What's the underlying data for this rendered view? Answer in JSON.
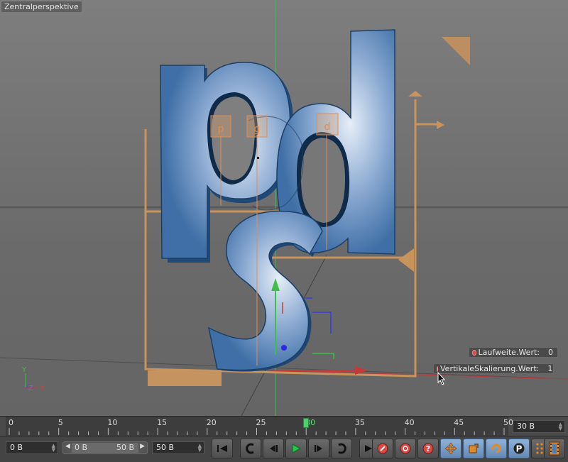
{
  "viewport": {
    "label": "Zentralperspektive",
    "axis_labels": {
      "y": "Y",
      "z": "Z",
      "x": "X"
    },
    "letters": [
      "p",
      "g",
      "d",
      "s"
    ],
    "hud": [
      {
        "label": "Laufweite.Wert:",
        "value": "0"
      },
      {
        "label": "VertikaleSkalierung.Wert:",
        "value": "1"
      }
    ]
  },
  "timeline": {
    "ticks": [
      "0",
      "5",
      "10",
      "15",
      "20",
      "25",
      "30",
      "35",
      "40",
      "45",
      "50"
    ],
    "current_frame": "30",
    "end_field": "30 B"
  },
  "controls": {
    "start_field": "0 B",
    "range_min": "0 B",
    "range_max": "50 B",
    "end_field": "50 B",
    "playback_buttons": [
      "go-to-start",
      "previous-key",
      "previous-frame",
      "play",
      "next-frame",
      "next-key",
      "go-to-end"
    ],
    "record_buttons": [
      "record-keys",
      "autokey",
      "help"
    ],
    "key_buttons": [
      "move",
      "scale",
      "rotate",
      "parameter",
      "point-level"
    ],
    "timeline_button": "film-icon"
  },
  "colors": {
    "accent": "#d9a066",
    "text_blue": "#4a7fb5",
    "current_frame": "#5de07a",
    "record": "#d94a45"
  }
}
